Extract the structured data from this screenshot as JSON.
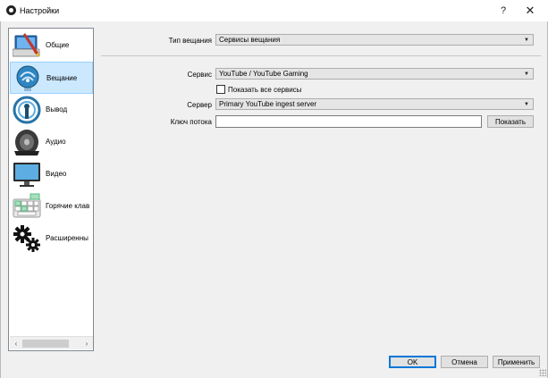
{
  "window": {
    "title": "Настройки",
    "help_label": "?",
    "close_label": "✕"
  },
  "sidebar": {
    "items": [
      {
        "label": "Общие",
        "icon": "general-icon"
      },
      {
        "label": "Вещание",
        "icon": "broadcast-icon",
        "active": true
      },
      {
        "label": "Вывод",
        "icon": "output-icon"
      },
      {
        "label": "Аудио",
        "icon": "audio-icon"
      },
      {
        "label": "Видео",
        "icon": "video-icon"
      },
      {
        "label": "Горячие клав",
        "icon": "hotkeys-icon"
      },
      {
        "label": "Расширенны",
        "icon": "advanced-icon"
      }
    ],
    "scroll_left": "‹",
    "scroll_right": "›"
  },
  "stream": {
    "type_label": "Тип вещания",
    "type_value": "Сервисы вещания",
    "service_label": "Сервис",
    "service_value": "YouTube / YouTube Gaming",
    "show_all_label": "Показать все сервисы",
    "show_all_checked": false,
    "server_label": "Сервер",
    "server_value": "Primary YouTube ingest server",
    "key_label": "Ключ потока",
    "key_value": "",
    "show_button": "Показать",
    "dropdown_arrow": "▼"
  },
  "footer": {
    "ok": "OK",
    "cancel": "Отмена",
    "apply": "Применить"
  },
  "colors": {
    "accent": "#0078d7",
    "selection": "#cce8ff"
  }
}
